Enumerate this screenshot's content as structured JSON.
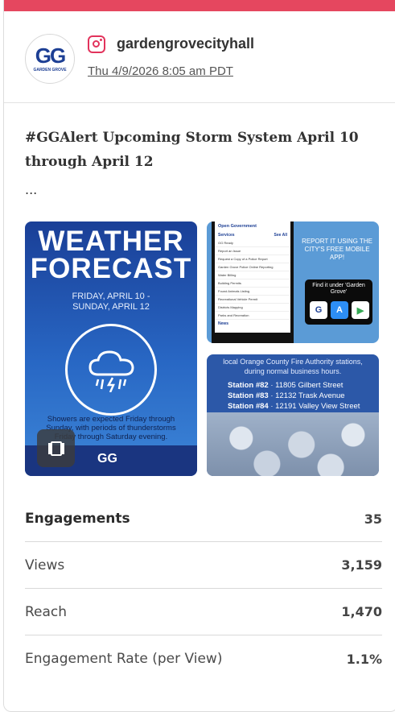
{
  "header": {
    "username": "gardengrovecityhall",
    "timestamp": "Thu 4/9/2026 8:05 am PDT",
    "avatar_text": "GARDEN GROVE"
  },
  "post": {
    "text": "#GGAlert Upcoming Storm System April 10 through April 12",
    "more": "..."
  },
  "media": {
    "main": {
      "title_line1": "WEATHER",
      "title_line2": "FORECAST",
      "date_line1": "FRIDAY, APRIL 10 -",
      "date_line2": "SUNDAY, APRIL 12",
      "description": "Showers are expected Friday through Sunday, with periods of thunderstorms Friday through Saturday evening.",
      "logo": "Garden Grove"
    },
    "app": {
      "phone_header": "Open Government",
      "phone_services": "Services",
      "phone_see_all": "See All",
      "phone_items": [
        "GG Ready",
        "Report an Issue",
        "Request a Copy of a Police Report",
        "Garden Grove Police Online Reporting",
        "Water Billing",
        "Building Permits",
        "Found Animals Listing",
        "Recreational Vehicle Permit",
        "Districts Mapping",
        "Parks and Recreation"
      ],
      "phone_news": "News",
      "report_text": "REPORT IT USING THE CITY'S FREE MOBILE APP!",
      "store_title": "Find it under 'Garden Grove'"
    },
    "stations": {
      "intro_line1": "local Orange County Fire Authority stations,",
      "intro_line2": "during normal business hours.",
      "items": [
        {
          "name": "Station #82",
          "address": "· 11805 Gilbert Street"
        },
        {
          "name": "Station #83",
          "address": "· 12132 Trask Avenue"
        },
        {
          "name": "Station #84",
          "address": "· 12191 Valley View Street"
        }
      ]
    }
  },
  "metrics": [
    {
      "label": "Engagements",
      "value": "35"
    },
    {
      "label": "Views",
      "value": "3,159"
    },
    {
      "label": "Reach",
      "value": "1,470"
    },
    {
      "label": "Engagement Rate (per View)",
      "value": "1.1%"
    }
  ],
  "colors": {
    "top_bar": "#e5475f",
    "instagram": "#e2335c",
    "brand_blue": "#1d3f94"
  },
  "icons": [
    "instagram-icon",
    "carousel-icon",
    "storm-cloud-icon",
    "app-store-icon",
    "google-play-icon"
  ]
}
